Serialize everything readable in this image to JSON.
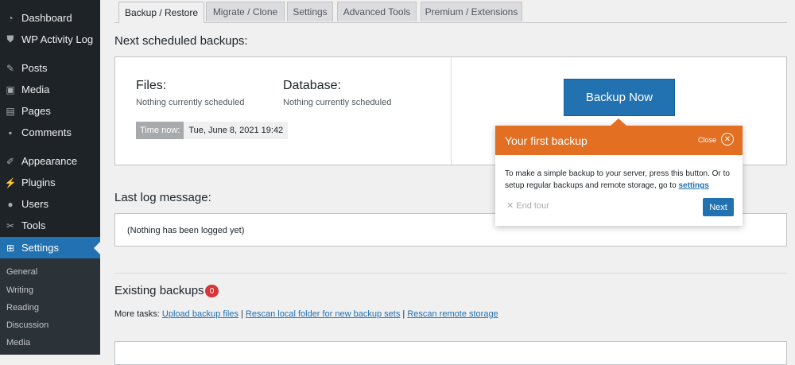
{
  "sidebar": {
    "items": [
      {
        "label": "Dashboard",
        "icon": "dashboard-icon",
        "glyph": "◔"
      },
      {
        "label": "WP Activity Log",
        "icon": "shield-icon",
        "glyph": "⛊"
      },
      {
        "label": "Posts",
        "icon": "pin-icon",
        "glyph": "✎"
      },
      {
        "label": "Media",
        "icon": "media-icon",
        "glyph": "▣"
      },
      {
        "label": "Pages",
        "icon": "pages-icon",
        "glyph": "▤"
      },
      {
        "label": "Comments",
        "icon": "comments-icon",
        "glyph": "▪"
      },
      {
        "label": "Appearance",
        "icon": "brush-icon",
        "glyph": "✐"
      },
      {
        "label": "Plugins",
        "icon": "plug-icon",
        "glyph": "⚡"
      },
      {
        "label": "Users",
        "icon": "users-icon",
        "glyph": "●"
      },
      {
        "label": "Tools",
        "icon": "wrench-icon",
        "glyph": "✂"
      },
      {
        "label": "Settings",
        "icon": "settings-icon",
        "glyph": "⊞"
      }
    ],
    "submenu": [
      "General",
      "Writing",
      "Reading",
      "Discussion",
      "Media"
    ]
  },
  "tabs": [
    "Backup / Restore",
    "Migrate / Clone",
    "Settings",
    "Advanced Tools",
    "Premium / Extensions"
  ],
  "scheduled": {
    "heading": "Next scheduled backups:",
    "files_label": "Files:",
    "files_status": "Nothing currently scheduled",
    "db_label": "Database:",
    "db_status": "Nothing currently scheduled",
    "time_label": "Time now:",
    "time_value": "Tue, June 8, 2021 19:42",
    "backup_button": "Backup Now"
  },
  "log": {
    "heading": "Last log message:",
    "message": "(Nothing has been logged yet)"
  },
  "existing": {
    "heading": "Existing backups",
    "count": "0",
    "more_tasks_label": "More tasks:",
    "links": [
      "Upload backup files",
      "Rescan local folder for new backup sets",
      "Rescan remote storage"
    ]
  },
  "tour": {
    "title": "Your first backup",
    "close_label": "Close",
    "body_text": "To make a simple backup to your server, press this button. Or to setup regular backups and remote storage, go to",
    "body_link": "settings",
    "end_tour": "End tour",
    "next": "Next"
  },
  "colors": {
    "admin_bar": "#1d2327",
    "accent": "#2271b1",
    "tour_header": "#e26f22",
    "badge": "#d63638"
  }
}
